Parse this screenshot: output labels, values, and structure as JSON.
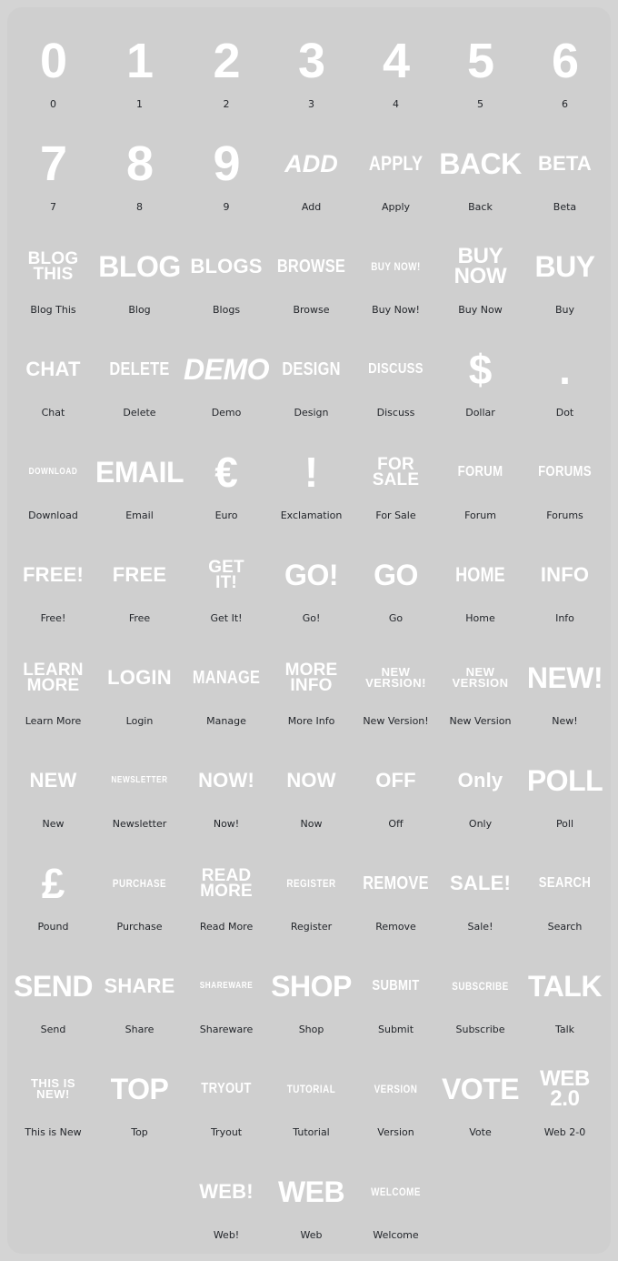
{
  "page": {
    "background_color": "#d4d4d4",
    "sheet_color": "#cfcfcf",
    "art_color": "#ffffff",
    "caption_color": "#23262b"
  },
  "items": [
    {
      "caption": "0",
      "lines": [
        "0"
      ],
      "style": "s-num"
    },
    {
      "caption": "1",
      "lines": [
        "1"
      ],
      "style": "s-num"
    },
    {
      "caption": "2",
      "lines": [
        "2"
      ],
      "style": "s-num"
    },
    {
      "caption": "3",
      "lines": [
        "3"
      ],
      "style": "s-num"
    },
    {
      "caption": "4",
      "lines": [
        "4"
      ],
      "style": "s-num"
    },
    {
      "caption": "5",
      "lines": [
        "5"
      ],
      "style": "s-num"
    },
    {
      "caption": "6",
      "lines": [
        "6"
      ],
      "style": "s-num"
    },
    {
      "caption": "7",
      "lines": [
        "7"
      ],
      "style": "s-num"
    },
    {
      "caption": "8",
      "lines": [
        "8"
      ],
      "style": "s-num"
    },
    {
      "caption": "9",
      "lines": [
        "9"
      ],
      "style": "s-num"
    },
    {
      "caption": "Add",
      "lines": [
        "ADD"
      ],
      "style": "s-big w-ital"
    },
    {
      "caption": "Apply",
      "lines": [
        "APPLY"
      ],
      "style": "s-mid w-cond"
    },
    {
      "caption": "Back",
      "lines": [
        "BACK"
      ],
      "style": "s-huge"
    },
    {
      "caption": "Beta",
      "lines": [
        "BETA"
      ],
      "style": "s-mid"
    },
    {
      "caption": "Blog This",
      "lines": [
        "BLOG",
        "THIS"
      ],
      "style": "s-stack1 stacked"
    },
    {
      "caption": "Blog",
      "lines": [
        "BLOG"
      ],
      "style": "s-huge"
    },
    {
      "caption": "Blogs",
      "lines": [
        "BLOGS"
      ],
      "style": "s-mid"
    },
    {
      "caption": "Browse",
      "lines": [
        "BROWSE"
      ],
      "style": "s-mids w-cond"
    },
    {
      "caption": "Buy Now!",
      "lines": [
        "BUY NOW!"
      ],
      "style": "s-tiny w-cond"
    },
    {
      "caption": "Buy Now",
      "lines": [
        "BUY",
        "NOW"
      ],
      "style": "s-stackbig stacked"
    },
    {
      "caption": "Buy",
      "lines": [
        "BUY"
      ],
      "style": "s-huge"
    },
    {
      "caption": "Chat",
      "lines": [
        "CHAT"
      ],
      "style": "s-mid"
    },
    {
      "caption": "Delete",
      "lines": [
        "DELETE"
      ],
      "style": "s-mids w-cond"
    },
    {
      "caption": "Demo",
      "lines": [
        "DEMO"
      ],
      "style": "s-huge w-ital"
    },
    {
      "caption": "Design",
      "lines": [
        "DESIGN"
      ],
      "style": "s-mids w-cond"
    },
    {
      "caption": "Discuss",
      "lines": [
        "DISCUSS"
      ],
      "style": "s-small w-cond"
    },
    {
      "caption": "Dollar",
      "lines": [
        "$"
      ],
      "style": "s-symbol"
    },
    {
      "caption": "Dot",
      "lines": [
        "."
      ],
      "style": "s-dot"
    },
    {
      "caption": "Download",
      "lines": [
        "DOWNLOAD"
      ],
      "style": "s-xtiny w-cond"
    },
    {
      "caption": "Email",
      "lines": [
        "EMAIL"
      ],
      "style": "s-huge"
    },
    {
      "caption": "Euro",
      "lines": [
        "€"
      ],
      "style": "s-symbol"
    },
    {
      "caption": "Exclamation",
      "lines": [
        "!"
      ],
      "style": "s-symbol"
    },
    {
      "caption": "For Sale",
      "lines": [
        "FOR",
        "SALE"
      ],
      "style": "s-stack1 stacked"
    },
    {
      "caption": "Forum",
      "lines": [
        "FORUM"
      ],
      "style": "s-small w-cond"
    },
    {
      "caption": "Forums",
      "lines": [
        "FORUMS"
      ],
      "style": "s-small w-cond"
    },
    {
      "caption": "Free!",
      "lines": [
        "FREE!"
      ],
      "style": "s-mid"
    },
    {
      "caption": "Free",
      "lines": [
        "FREE"
      ],
      "style": "s-mid"
    },
    {
      "caption": "Get It!",
      "lines": [
        "GET",
        "IT!"
      ],
      "style": "s-stack1 stacked"
    },
    {
      "caption": "Go!",
      "lines": [
        "GO!"
      ],
      "style": "s-huge"
    },
    {
      "caption": "Go",
      "lines": [
        "GO"
      ],
      "style": "s-huge"
    },
    {
      "caption": "Home",
      "lines": [
        "HOME"
      ],
      "style": "s-mid w-cond"
    },
    {
      "caption": "Info",
      "lines": [
        "INFO"
      ],
      "style": "s-mid"
    },
    {
      "caption": "Learn More",
      "lines": [
        "LEARN",
        "MORE"
      ],
      "style": "s-stack1 stacked"
    },
    {
      "caption": "Login",
      "lines": [
        "LOGIN"
      ],
      "style": "s-mid"
    },
    {
      "caption": "Manage",
      "lines": [
        "MANAGE"
      ],
      "style": "s-mids w-cond"
    },
    {
      "caption": "More Info",
      "lines": [
        "MORE",
        "INFO"
      ],
      "style": "s-stack1 stacked"
    },
    {
      "caption": "New Version!",
      "lines": [
        "NEW",
        "VERSION!"
      ],
      "style": "s-stacksm stacked"
    },
    {
      "caption": "New Version",
      "lines": [
        "NEW",
        "VERSION"
      ],
      "style": "s-stacksm stacked"
    },
    {
      "caption": "New!",
      "lines": [
        "NEW!"
      ],
      "style": "s-huge"
    },
    {
      "caption": "New",
      "lines": [
        "NEW"
      ],
      "style": "s-mid"
    },
    {
      "caption": "Newsletter",
      "lines": [
        "NEWSLETTER"
      ],
      "style": "s-xtiny w-cond"
    },
    {
      "caption": "Now!",
      "lines": [
        "NOW!"
      ],
      "style": "s-mid"
    },
    {
      "caption": "Now",
      "lines": [
        "NOW"
      ],
      "style": "s-mid"
    },
    {
      "caption": "Off",
      "lines": [
        "OFF"
      ],
      "style": "s-mid"
    },
    {
      "caption": "Only",
      "lines": [
        "Only"
      ],
      "style": "s-mid"
    },
    {
      "caption": "Poll",
      "lines": [
        "POLL"
      ],
      "style": "s-huge"
    },
    {
      "caption": "Pound",
      "lines": [
        "£"
      ],
      "style": "s-symbol"
    },
    {
      "caption": "Purchase",
      "lines": [
        "PURCHASE"
      ],
      "style": "s-tiny w-cond"
    },
    {
      "caption": "Read More",
      "lines": [
        "READ",
        "MORE"
      ],
      "style": "s-stack1 stacked"
    },
    {
      "caption": "Register",
      "lines": [
        "REGISTER"
      ],
      "style": "s-tiny w-cond"
    },
    {
      "caption": "Remove",
      "lines": [
        "REMOVE"
      ],
      "style": "s-mids w-cond"
    },
    {
      "caption": "Sale!",
      "lines": [
        "SALE!"
      ],
      "style": "s-mid"
    },
    {
      "caption": "Search",
      "lines": [
        "SEARCH"
      ],
      "style": "s-small w-cond"
    },
    {
      "caption": "Send",
      "lines": [
        "SEND"
      ],
      "style": "s-huge"
    },
    {
      "caption": "Share",
      "lines": [
        "SHARE"
      ],
      "style": "s-mid"
    },
    {
      "caption": "Shareware",
      "lines": [
        "SHAREWARE"
      ],
      "style": "s-xtiny w-cond"
    },
    {
      "caption": "Shop",
      "lines": [
        "SHOP"
      ],
      "style": "s-huge"
    },
    {
      "caption": "Submit",
      "lines": [
        "SUBMIT"
      ],
      "style": "s-small w-cond"
    },
    {
      "caption": "Subscribe",
      "lines": [
        "SUBSCRIBE"
      ],
      "style": "s-tiny w-cond"
    },
    {
      "caption": "Talk",
      "lines": [
        "TALK"
      ],
      "style": "s-huge"
    },
    {
      "caption": "This is New",
      "lines": [
        "THIS IS",
        "NEW!"
      ],
      "style": "s-stacksm stacked"
    },
    {
      "caption": "Top",
      "lines": [
        "TOP"
      ],
      "style": "s-huge"
    },
    {
      "caption": "Tryout",
      "lines": [
        "TRYOUT"
      ],
      "style": "s-small w-cond"
    },
    {
      "caption": "Tutorial",
      "lines": [
        "TUTORIAL"
      ],
      "style": "s-tiny w-cond"
    },
    {
      "caption": "Version",
      "lines": [
        "VERSION"
      ],
      "style": "s-tiny w-cond"
    },
    {
      "caption": "Vote",
      "lines": [
        "VOTE"
      ],
      "style": "s-huge"
    },
    {
      "caption": "Web 2-0",
      "lines": [
        "WEB",
        "2.0"
      ],
      "style": "s-stackbig stacked"
    },
    {
      "caption": "",
      "lines": [],
      "style": "",
      "empty": true
    },
    {
      "caption": "",
      "lines": [],
      "style": "",
      "empty": true
    },
    {
      "caption": "Web!",
      "lines": [
        "WEB!"
      ],
      "style": "s-mid"
    },
    {
      "caption": "Web",
      "lines": [
        "WEB"
      ],
      "style": "s-huge"
    },
    {
      "caption": "Welcome",
      "lines": [
        "WELCOME"
      ],
      "style": "s-tiny w-cond"
    },
    {
      "caption": "",
      "lines": [],
      "style": "",
      "empty": true
    },
    {
      "caption": "",
      "lines": [],
      "style": "",
      "empty": true
    }
  ]
}
